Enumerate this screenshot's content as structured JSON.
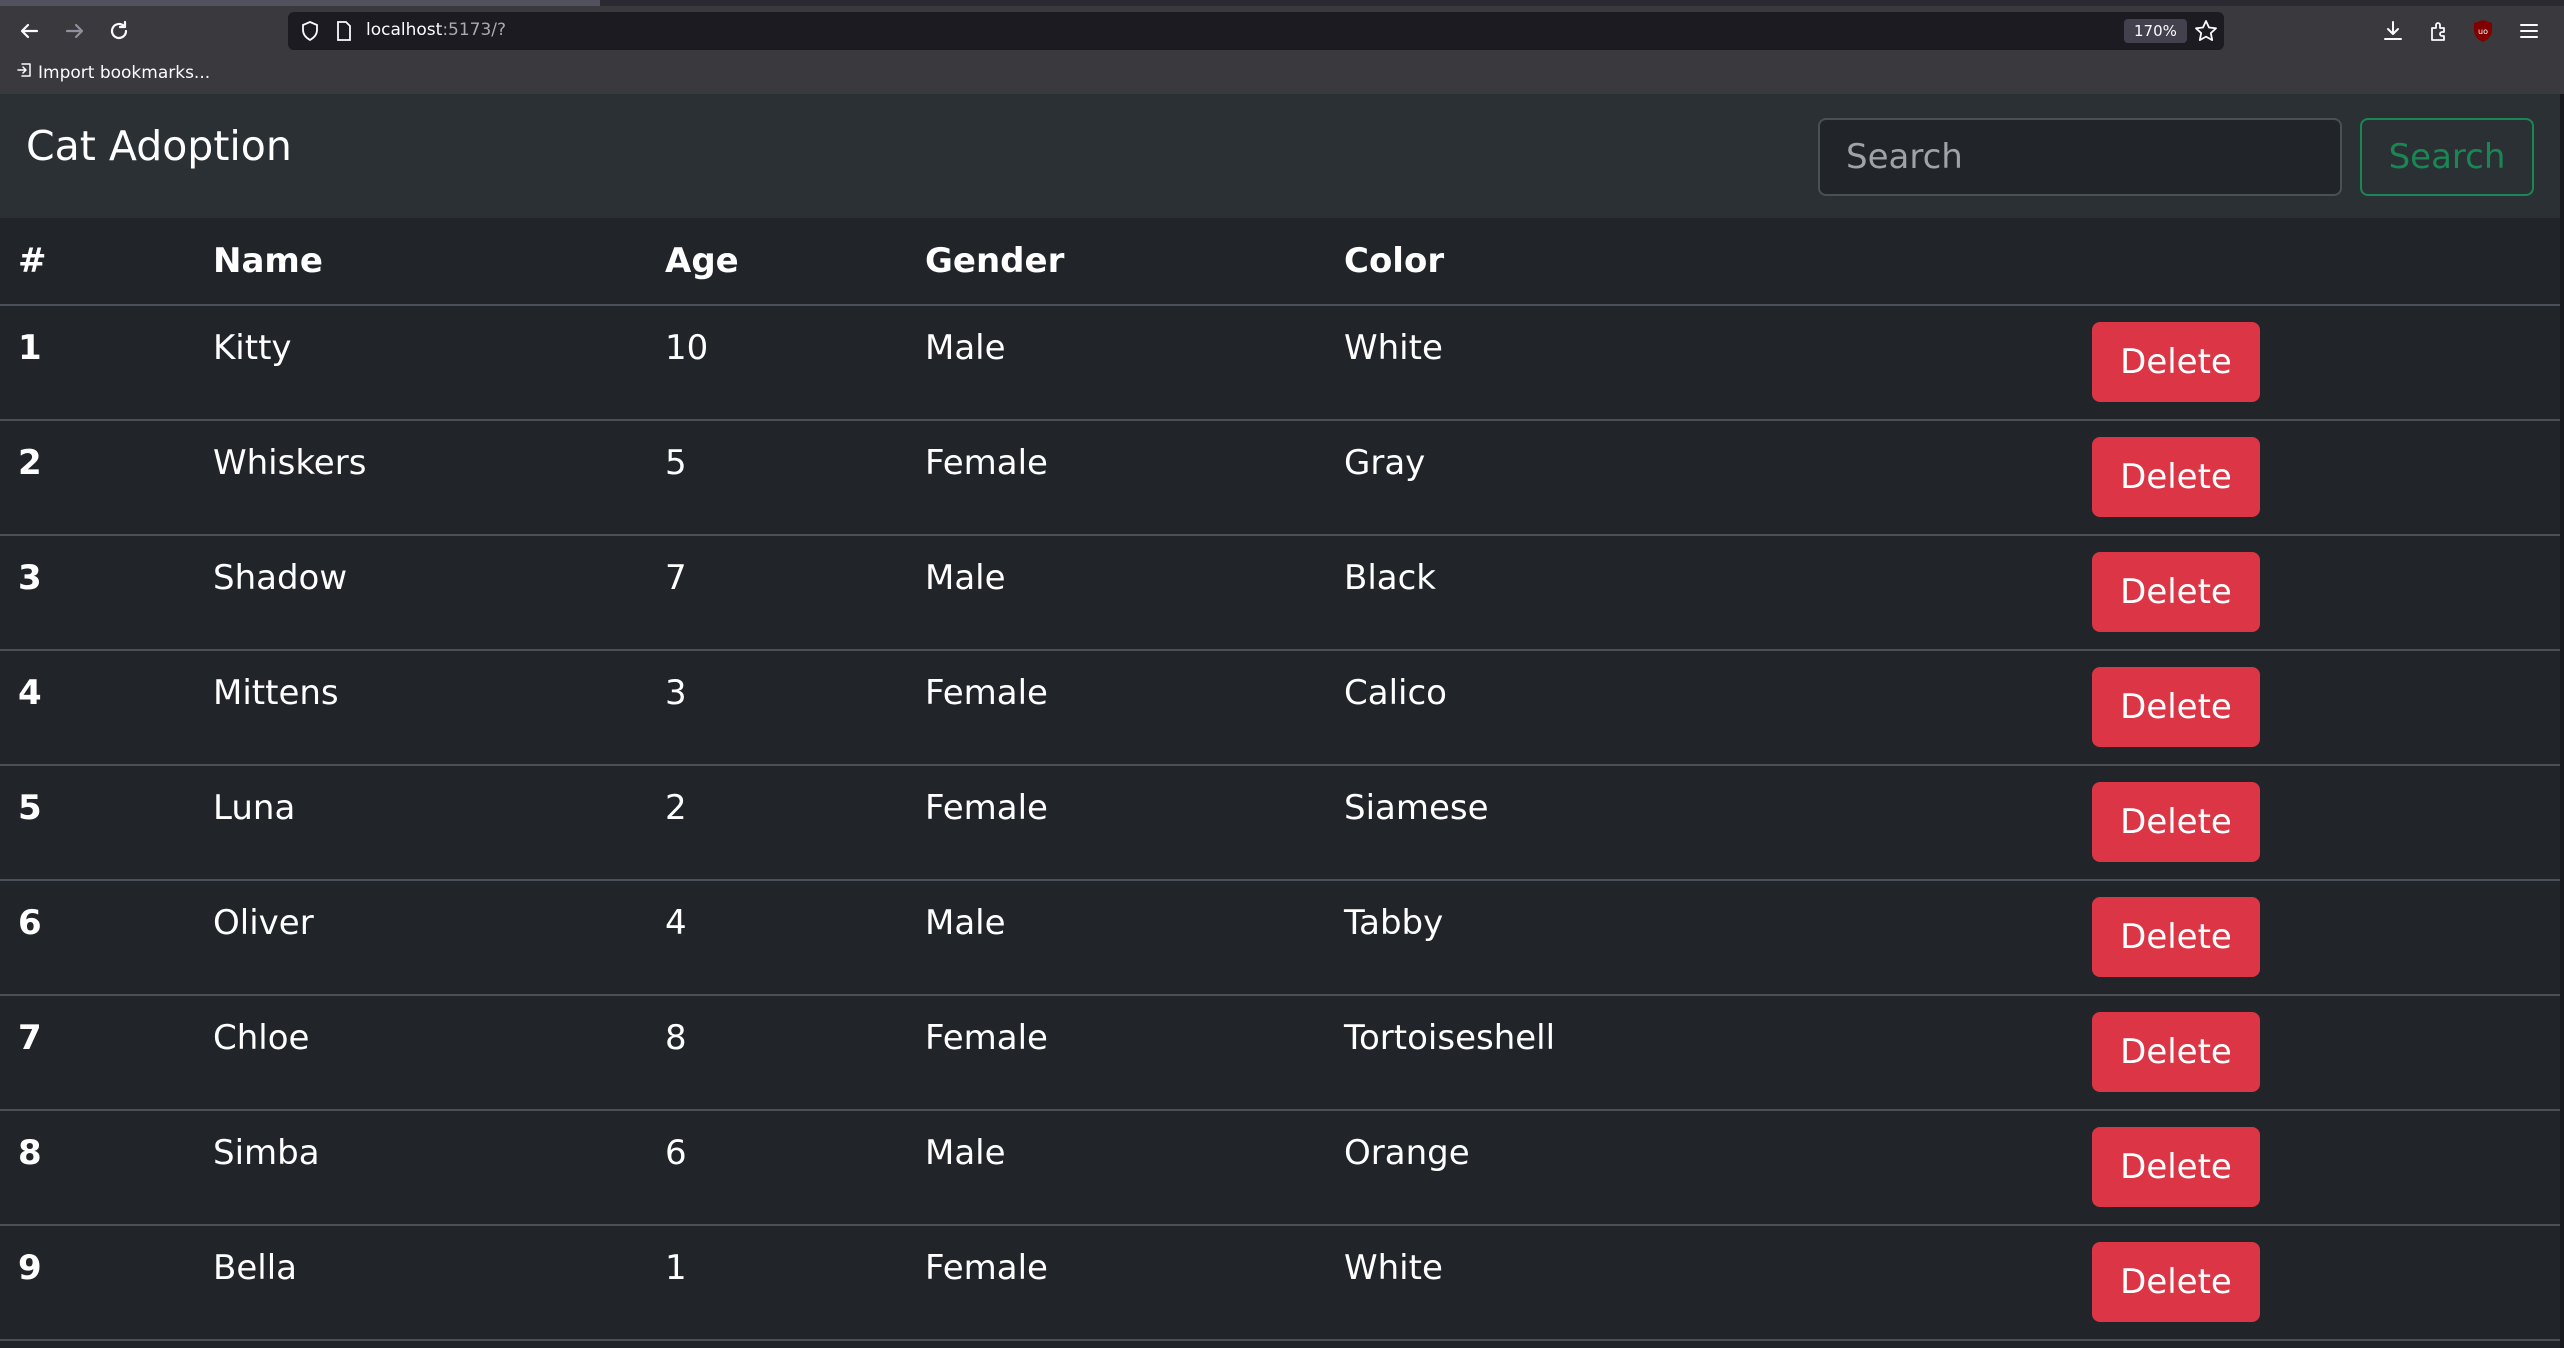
{
  "browser": {
    "url_host": "localhost",
    "url_rest": ":5173/?",
    "zoom": "170%",
    "bookmarks_import_label": "Import bookmarks..."
  },
  "navbar": {
    "brand": "Cat Adoption",
    "search_placeholder": "Search",
    "search_value": "",
    "search_button_label": "Search"
  },
  "table": {
    "headers": [
      "#",
      "Name",
      "Age",
      "Gender",
      "Color",
      ""
    ],
    "rows": [
      {
        "id": "1",
        "name": "Kitty",
        "age": "10",
        "gender": "Male",
        "color": "White",
        "action": "Delete"
      },
      {
        "id": "2",
        "name": "Whiskers",
        "age": "5",
        "gender": "Female",
        "color": "Gray",
        "action": "Delete"
      },
      {
        "id": "3",
        "name": "Shadow",
        "age": "7",
        "gender": "Male",
        "color": "Black",
        "action": "Delete"
      },
      {
        "id": "4",
        "name": "Mittens",
        "age": "3",
        "gender": "Female",
        "color": "Calico",
        "action": "Delete"
      },
      {
        "id": "5",
        "name": "Luna",
        "age": "2",
        "gender": "Female",
        "color": "Siamese",
        "action": "Delete"
      },
      {
        "id": "6",
        "name": "Oliver",
        "age": "4",
        "gender": "Male",
        "color": "Tabby",
        "action": "Delete"
      },
      {
        "id": "7",
        "name": "Chloe",
        "age": "8",
        "gender": "Female",
        "color": "Tortoiseshell",
        "action": "Delete"
      },
      {
        "id": "8",
        "name": "Simba",
        "age": "6",
        "gender": "Male",
        "color": "Orange",
        "action": "Delete"
      },
      {
        "id": "9",
        "name": "Bella",
        "age": "1",
        "gender": "Female",
        "color": "White",
        "action": "Delete"
      }
    ]
  },
  "colors": {
    "page_background": "#212529",
    "navbar_background": "#2b3035",
    "delete_button": "#dc3545",
    "search_button_outline": "#198754"
  },
  "icons": [
    "back-arrow-icon",
    "forward-arrow-icon",
    "reload-icon",
    "shield-icon",
    "page-icon",
    "star-icon",
    "download-icon",
    "extensions-icon",
    "ublock-icon",
    "menu-icon",
    "import-icon"
  ]
}
